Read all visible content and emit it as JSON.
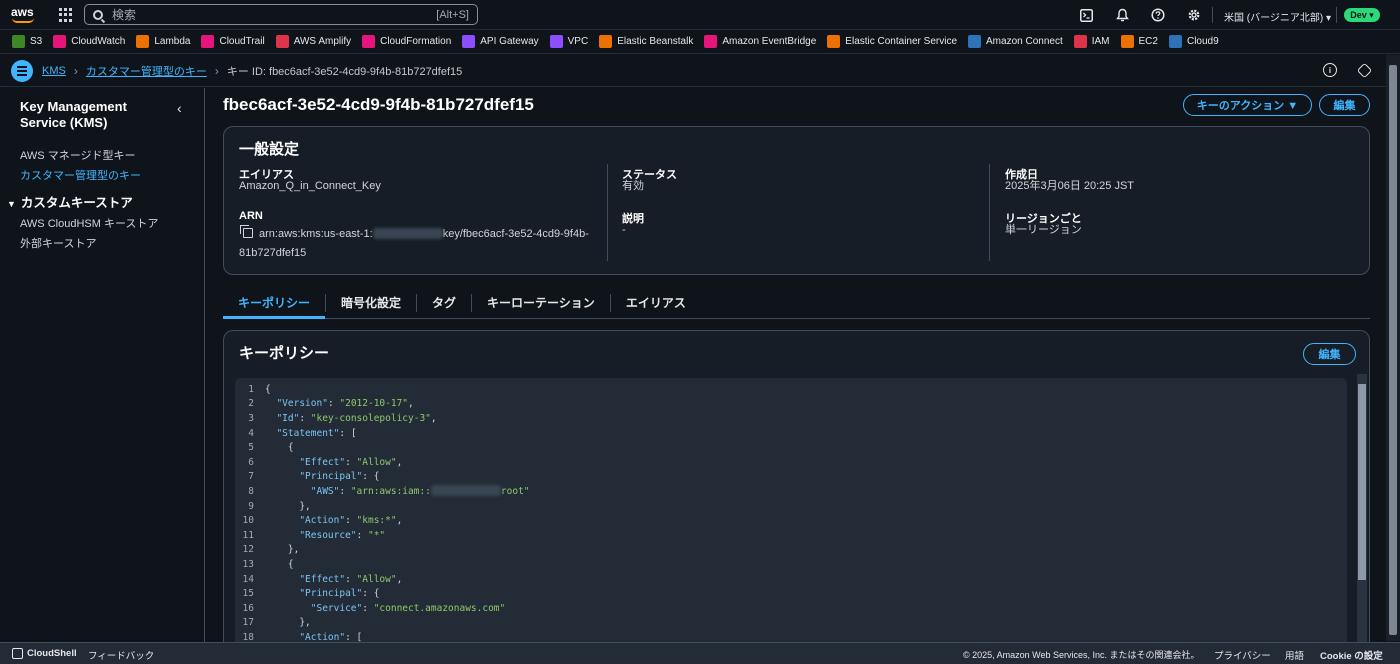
{
  "topbar": {
    "logo_text": "aws",
    "search_placeholder": "検索",
    "search_shortcut": "[Alt+S]",
    "region": "米国 (バージニア北部) ▾",
    "account_badge": "Dev ▾",
    "icons": [
      "cloudshell-icon",
      "bell-icon",
      "help-icon",
      "gear-icon"
    ]
  },
  "favorites": [
    {
      "label": "S3",
      "color": "#3f8624",
      "icon": "s3-icon"
    },
    {
      "label": "CloudWatch",
      "color": "#e7157b",
      "icon": "cloudwatch-icon"
    },
    {
      "label": "Lambda",
      "color": "#ed7100",
      "icon": "lambda-icon"
    },
    {
      "label": "CloudTrail",
      "color": "#e7157b",
      "icon": "cloudtrail-icon"
    },
    {
      "label": "AWS Amplify",
      "color": "#dd344c",
      "icon": "amplify-icon"
    },
    {
      "label": "CloudFormation",
      "color": "#e7157b",
      "icon": "cloudformation-icon"
    },
    {
      "label": "API Gateway",
      "color": "#8c4fff",
      "icon": "api-gateway-icon"
    },
    {
      "label": "VPC",
      "color": "#8c4fff",
      "icon": "vpc-icon"
    },
    {
      "label": "Elastic Beanstalk",
      "color": "#ed7100",
      "icon": "beanstalk-icon"
    },
    {
      "label": "Amazon EventBridge",
      "color": "#e7157b",
      "icon": "eventbridge-icon"
    },
    {
      "label": "Elastic Container Service",
      "color": "#ed7100",
      "icon": "ecs-icon"
    },
    {
      "label": "Amazon Connect",
      "color": "#2e73b8",
      "icon": "connect-icon"
    },
    {
      "label": "IAM",
      "color": "#dd344c",
      "icon": "iam-icon"
    },
    {
      "label": "EC2",
      "color": "#ed7100",
      "icon": "ec2-icon"
    },
    {
      "label": "Cloud9",
      "color": "#2e73b8",
      "icon": "cloud9-icon"
    }
  ],
  "breadcrumb": {
    "items": [
      "KMS",
      "カスタマー管理型のキー"
    ],
    "current": "キー ID: fbec6acf-3e52-4cd9-9f4b-81b727dfef15"
  },
  "sidebar": {
    "title": "Key Management Service (KMS)",
    "links": [
      "AWS マネージド型キー",
      "カスタマー管理型のキー"
    ],
    "group": "カスタムキーストア",
    "group_links": [
      "AWS CloudHSM キーストア",
      "外部キーストア"
    ]
  },
  "page": {
    "title": "fbec6acf-3e52-4cd9-9f4b-81b727dfef15",
    "actions_label": "キーのアクション ▼",
    "edit_label": "編集"
  },
  "general": {
    "heading": "一般設定",
    "alias_label": "エイリアス",
    "alias_value": "Amazon_Q_in_Connect_Key",
    "arn_label": "ARN",
    "arn_prefix": "arn:aws:kms:us-east-1:",
    "arn_suffix": "key/fbec6acf-3e52-4cd9-9f4b-",
    "arn_line2": "81b727dfef15",
    "status_label": "ステータス",
    "status_value": "有効",
    "desc_label": "説明",
    "desc_value": "-",
    "created_label": "作成日",
    "created_value": "2025年3月06日 20:25 JST",
    "region_label": "リージョンごと",
    "region_value": "単一リージョン"
  },
  "tabs": [
    "キーポリシー",
    "暗号化設定",
    "タグ",
    "キーローテーション",
    "エイリアス"
  ],
  "policy": {
    "heading": "キーポリシー",
    "edit_label": "編集",
    "lines": [
      [
        {
          "t": "{"
        }
      ],
      [
        {
          "t": "  "
        },
        {
          "k": "\"Version\""
        },
        {
          "t": ": "
        },
        {
          "s": "\"2012-10-17\""
        },
        {
          "t": ","
        }
      ],
      [
        {
          "t": "  "
        },
        {
          "k": "\"Id\""
        },
        {
          "t": ": "
        },
        {
          "s": "\"key-consolepolicy-3\""
        },
        {
          "t": ","
        }
      ],
      [
        {
          "t": "  "
        },
        {
          "k": "\"Statement\""
        },
        {
          "t": ": ["
        }
      ],
      [
        {
          "t": "    {"
        }
      ],
      [
        {
          "t": "      "
        },
        {
          "k": "\"Effect\""
        },
        {
          "t": ": "
        },
        {
          "s": "\"Allow\""
        },
        {
          "t": ","
        }
      ],
      [
        {
          "t": "      "
        },
        {
          "k": "\"Principal\""
        },
        {
          "t": ": {"
        }
      ],
      [
        {
          "t": "        "
        },
        {
          "k": "\"AWS\""
        },
        {
          "t": ": "
        },
        {
          "s": "\"arn:aws:iam::"
        },
        {
          "blur": true
        },
        {
          "s": "root\""
        }
      ],
      [
        {
          "t": "      },"
        }
      ],
      [
        {
          "t": "      "
        },
        {
          "k": "\"Action\""
        },
        {
          "t": ": "
        },
        {
          "s": "\"kms:*\""
        },
        {
          "t": ","
        }
      ],
      [
        {
          "t": "      "
        },
        {
          "k": "\"Resource\""
        },
        {
          "t": ": "
        },
        {
          "s": "\"*\""
        }
      ],
      [
        {
          "t": "    },"
        }
      ],
      [
        {
          "t": "    {"
        }
      ],
      [
        {
          "t": "      "
        },
        {
          "k": "\"Effect\""
        },
        {
          "t": ": "
        },
        {
          "s": "\"Allow\""
        },
        {
          "t": ","
        }
      ],
      [
        {
          "t": "      "
        },
        {
          "k": "\"Principal\""
        },
        {
          "t": ": {"
        }
      ],
      [
        {
          "t": "        "
        },
        {
          "k": "\"Service\""
        },
        {
          "t": ": "
        },
        {
          "s": "\"connect.amazonaws.com\""
        }
      ],
      [
        {
          "t": "      },"
        }
      ],
      [
        {
          "t": "      "
        },
        {
          "k": "\"Action\""
        },
        {
          "t": ": ["
        }
      ]
    ]
  },
  "footer": {
    "cloudshell": "CloudShell",
    "feedback": "フィードバック",
    "copyright": "© 2025, Amazon Web Services, Inc. またはその関連会社。",
    "privacy": "プライバシー",
    "terms": "用語",
    "cookie": "Cookie の設定"
  }
}
